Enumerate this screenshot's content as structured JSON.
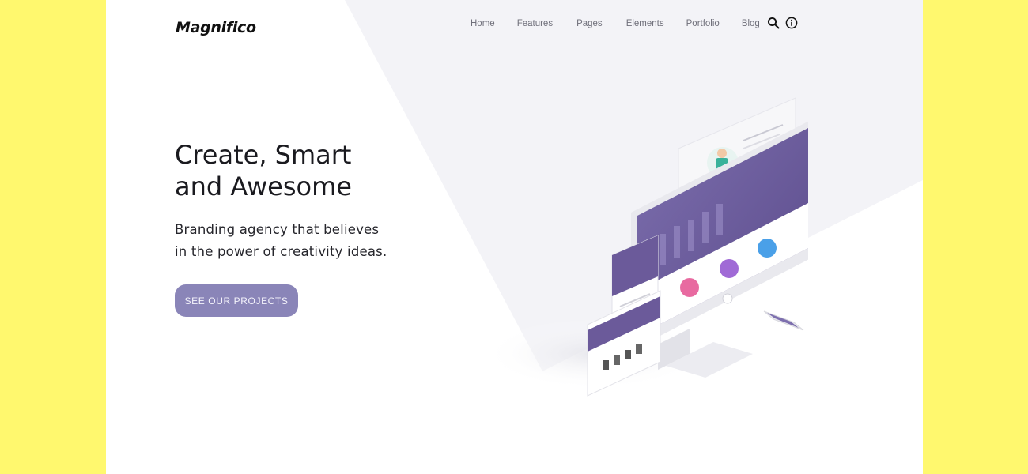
{
  "brand": {
    "name": "Magnifico"
  },
  "nav": {
    "items": [
      "Home",
      "Features",
      "Pages",
      "Elements",
      "Portfolio",
      "Blog"
    ],
    "icons": [
      "search-icon",
      "info-icon"
    ]
  },
  "hero": {
    "title_line1": "Create, Smart",
    "title_line2": "and Awesome",
    "subtitle_line1": "Branding agency that believes",
    "subtitle_line2": "in the power of creativity ideas.",
    "cta_label": "SEE OUR PROJECTS"
  },
  "colors": {
    "page_side": "#fff86e",
    "accent": "#8a85b8",
    "diagonal_band": "#f3f3f7",
    "mockup_purple": "#6b5a9a"
  }
}
